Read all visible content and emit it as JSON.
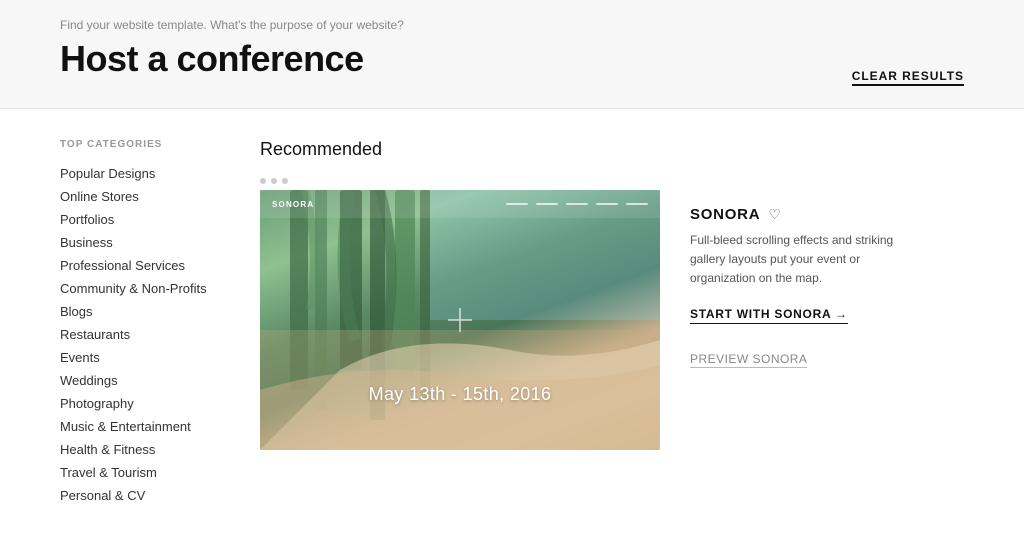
{
  "header": {
    "subtitle": "Find your website template. What's the purpose of your website?",
    "title": "Host a conference",
    "clear_results_label": "CLEAR RESULTS"
  },
  "sidebar": {
    "heading": "TOP CATEGORIES",
    "items": [
      {
        "label": "Popular Designs"
      },
      {
        "label": "Online Stores"
      },
      {
        "label": "Portfolios"
      },
      {
        "label": "Business"
      },
      {
        "label": "Professional Services"
      },
      {
        "label": "Community & Non-Profits"
      },
      {
        "label": "Blogs"
      },
      {
        "label": "Restaurants"
      },
      {
        "label": "Events"
      },
      {
        "label": "Weddings"
      },
      {
        "label": "Photography"
      },
      {
        "label": "Music & Entertainment"
      },
      {
        "label": "Health & Fitness"
      },
      {
        "label": "Travel & Tourism"
      },
      {
        "label": "Personal & CV"
      }
    ]
  },
  "main": {
    "recommended_heading": "Recommended",
    "template": {
      "name": "SONORA",
      "description": "Full-bleed scrolling effects and striking gallery layouts put your event or organization on the map.",
      "date_text": "May 13th - 15th, 2016",
      "start_label": "START WITH SONORA →",
      "preview_label": "PREVIEW SONORA",
      "heart_icon": "♡"
    }
  }
}
